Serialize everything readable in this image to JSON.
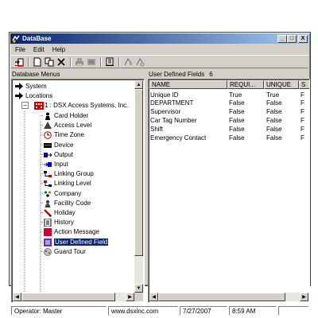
{
  "window": {
    "title": "DataBase",
    "minimize": "_",
    "maximize": "□",
    "close": "X"
  },
  "menu": [
    "File",
    "Edit",
    "Help"
  ],
  "toolbar": [
    "exit-icon",
    "new-icon",
    "copy-icon",
    "delete-icon",
    "print-icon",
    "print-preview-icon",
    "report-icon",
    "filter-icon",
    "find-icon"
  ],
  "left_header": "Database Menus",
  "right_header": {
    "label": "User Defined Fields",
    "count": "6"
  },
  "tree": {
    "system": "System",
    "locations": "Locations",
    "location_node": "1 : DSX Access Systems, Inc.",
    "items": [
      {
        "label": "Card Holder",
        "icon": "card-holder-icon"
      },
      {
        "label": "Access Level",
        "icon": "access-level-icon"
      },
      {
        "label": "Time Zone",
        "icon": "time-zone-icon"
      },
      {
        "label": "Device",
        "icon": "device-icon"
      },
      {
        "label": "Output",
        "icon": "output-icon"
      },
      {
        "label": "Input",
        "icon": "input-icon"
      },
      {
        "label": "Linking Group",
        "icon": "linking-group-icon"
      },
      {
        "label": "Linking Level",
        "icon": "linking-level-icon"
      },
      {
        "label": "Company",
        "icon": "company-icon"
      },
      {
        "label": "Facility Code",
        "icon": "facility-code-icon"
      },
      {
        "label": "Holiday",
        "icon": "holiday-icon"
      },
      {
        "label": "History",
        "icon": "history-icon"
      },
      {
        "label": "Action Message",
        "icon": "action-message-icon"
      },
      {
        "label": "User Defined Field",
        "icon": "user-defined-field-icon",
        "selected": true
      },
      {
        "label": "Guard Tour",
        "icon": "guard-tour-icon"
      }
    ]
  },
  "table": {
    "columns": [
      "NAME",
      "REQUI...",
      "UNIQUE",
      "S"
    ],
    "rows": [
      [
        "Unique ID",
        "True",
        "True",
        "F"
      ],
      [
        "DEPARTMENT",
        "False",
        "False",
        "F"
      ],
      [
        "Supervisor",
        "False",
        "False",
        "F"
      ],
      [
        "Car Tag Number",
        "False",
        "False",
        "F"
      ],
      [
        "Shift",
        "False",
        "False",
        "F"
      ],
      [
        "Emergency Contact",
        "False",
        "False",
        "F"
      ]
    ]
  },
  "status": {
    "operator": "Operator:  Master",
    "website": "www.dsxinc.com",
    "date": "7/27/2007",
    "time": "8:59 AM"
  },
  "colors": {
    "titlebar_start": "#0a246a",
    "titlebar_end": "#a6caf0",
    "selection": "#0a246a",
    "tree_node_red": "#cc0000"
  }
}
